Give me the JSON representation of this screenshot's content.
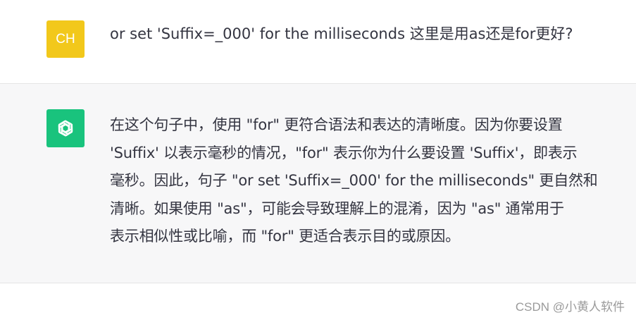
{
  "user_message": {
    "avatar_initials": "CH",
    "avatar_color": "#f2c81b",
    "text": "or set 'Suffix=_000' for the milliseconds  这里是用as还是for更好?"
  },
  "assistant_message": {
    "avatar_icon": "openai-logo-icon",
    "avatar_color": "#19c37d",
    "lines": [
      "在这个句子中，使用 \"for\" 更符合语法和表达的清晰度。因为你要设置",
      "'Suffix' 以表示毫秒的情况，\"for\" 表示你为什么要设置 'Suffix'，即表示",
      "毫秒。因此，句子 \"or set 'Suffix=_000' for the milliseconds\" 更自然和",
      "清晰。如果使用 \"as\"，可能会导致理解上的混淆，因为 \"as\" 通常用于",
      "表示相似性或比喻，而 \"for\" 更适合表示目的或原因。"
    ]
  },
  "watermark": "CSDN @小黄人软件"
}
